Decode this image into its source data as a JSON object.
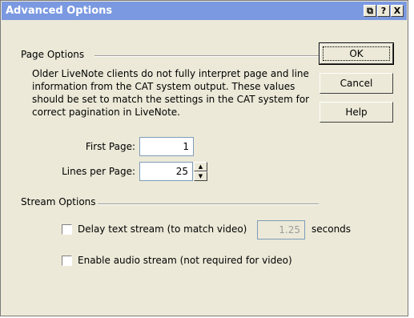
{
  "window": {
    "title": "Advanced Options",
    "title_buttons": [
      "⧉",
      "?",
      "X"
    ]
  },
  "page_options": {
    "group_label": "Page Options",
    "description": "Older LiveNote clients do not fully interpret page and line information from the CAT system output. These values should be set to match the settings in the CAT system for correct pagination in LiveNote.",
    "first_page_label": "First Page:",
    "first_page_value": "1",
    "lines_per_page_label": "Lines per Page:",
    "lines_per_page_value": "25"
  },
  "stream_options": {
    "group_label": "Stream Options",
    "delay_label": "Delay text stream (to match video)",
    "delay_checked": false,
    "delay_value": "1.25",
    "delay_unit": "seconds",
    "audio_label": "Enable audio stream (not required for video)",
    "audio_checked": false
  },
  "buttons": {
    "ok": "OK",
    "cancel": "Cancel",
    "help": "Help"
  },
  "colors": {
    "titlebar": "#7b99e1",
    "dialog_bg": "#ece9d8",
    "field_border": "#7f9db9"
  }
}
